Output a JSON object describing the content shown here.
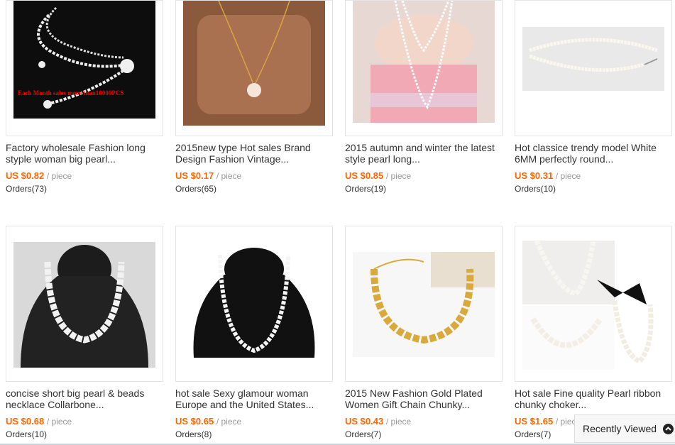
{
  "products": [
    {
      "title": "Factory wholesale Fashion long styple woman big pearl...",
      "price": "US $0.82",
      "unit": "/ piece",
      "orders": "Orders(73)",
      "image_caption": "Each Month sales more than10000PCS"
    },
    {
      "title": "2015new type Hot sales Brand Design Fashion Vintage...",
      "price": "US $0.17",
      "unit": "/ piece",
      "orders": "Orders(65)"
    },
    {
      "title": "2015 autumn and winter the latest style pearl long...",
      "price": "US $0.85",
      "unit": "/ piece",
      "orders": "Orders(19)"
    },
    {
      "title": "Hot classice trendy model White 6MM perfectly round...",
      "price": "US $0.31",
      "unit": "/ piece",
      "orders": "Orders(10)"
    },
    {
      "title": "concise short big pearl & beads necklace Collarbone...",
      "price": "US $0.68",
      "unit": "/ piece",
      "orders": "Orders(10)"
    },
    {
      "title": "hot sale Sexy glamour woman Europe and the United States...",
      "price": "US $0.65",
      "unit": "/ piece",
      "orders": "Orders(8)"
    },
    {
      "title": "2015 New Fashion Gold Plated Women Gift Chain Chunky...",
      "price": "US $0.43",
      "unit": "/ piece",
      "orders": "Orders(7)"
    },
    {
      "title": "Hot sale Fine quality Pearl ribbon chunky choker...",
      "price": "US $1.65",
      "unit": "/ piece",
      "orders": "Orders(7)"
    }
  ],
  "recently_viewed": {
    "label": "Recently Viewed",
    "icon": "chevron-up-icon"
  },
  "colors": {
    "price": "#ff6600",
    "border": "#e5e5e5",
    "text": "#333333"
  }
}
